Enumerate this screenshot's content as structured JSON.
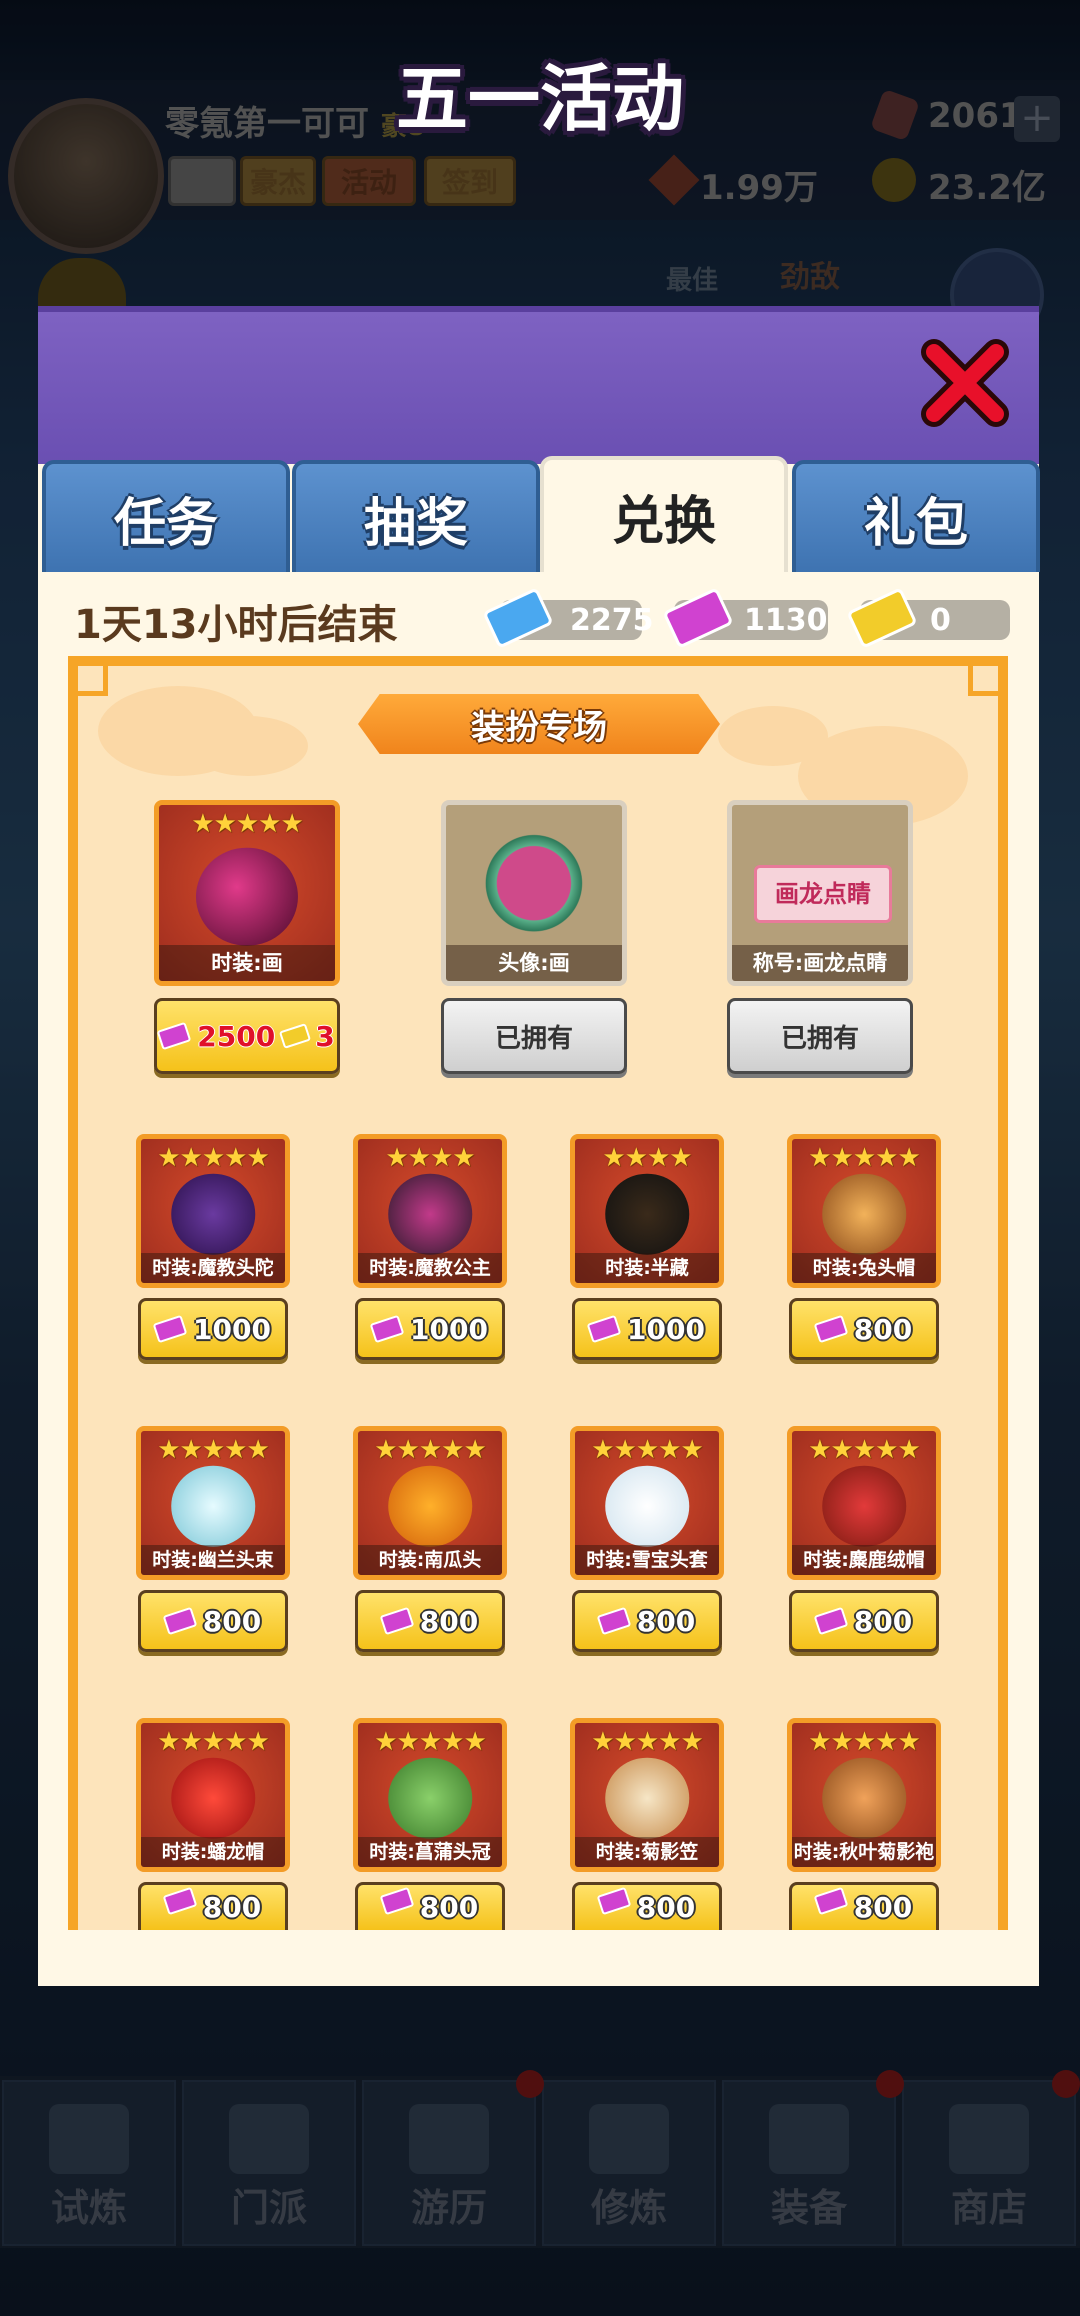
{
  "player": {
    "name": "零氪第一可可",
    "vip": "豪8",
    "menu": [
      "豪杰",
      "活动",
      "签到"
    ],
    "gems": "2061",
    "power": "1.99万",
    "coins": "23.2亿"
  },
  "modal": {
    "title": "五一活动",
    "tabs": [
      "任务",
      "抽奖",
      "兑换",
      "礼包"
    ],
    "active_tab": 2,
    "countdown": "1天13小时后结束",
    "currencies": [
      {
        "icon": "blue-ticket-icon",
        "color": "#4aa8f0",
        "value": "2275"
      },
      {
        "icon": "purple-ticket-icon",
        "color": "#d042d0",
        "value": "1130"
      },
      {
        "icon": "gold-ticket-icon",
        "color": "#f2cc2a",
        "value": "0"
      }
    ]
  },
  "shop": {
    "section_title": "装扮专场",
    "featured": [
      {
        "label": "时装:画",
        "stars": "★★★★★",
        "price": "2500",
        "price2": "3"
      },
      {
        "label": "头像:画",
        "status": "已拥有"
      },
      {
        "label": "称号:画龙点睛",
        "title_text": "画龙点睛",
        "status": "已拥有"
      }
    ],
    "items": [
      {
        "label": "时装:魔教头陀",
        "stars": "★★★★★",
        "price": "1000"
      },
      {
        "label": "时装:魔教公主",
        "stars": "★★★★",
        "price": "1000"
      },
      {
        "label": "时装:半藏",
        "stars": "★★★★",
        "price": "1000"
      },
      {
        "label": "时装:兔头帽",
        "stars": "★★★★★",
        "price": "800"
      },
      {
        "label": "时装:幽兰头束",
        "stars": "★★★★★",
        "price": "800"
      },
      {
        "label": "时装:南瓜头",
        "stars": "★★★★★",
        "price": "800"
      },
      {
        "label": "时装:雪宝头套",
        "stars": "★★★★★",
        "price": "800"
      },
      {
        "label": "时装:麋鹿绒帽",
        "stars": "★★★★★",
        "price": "800"
      },
      {
        "label": "时装:蟠龙帽",
        "stars": "★★★★★",
        "price": "800"
      },
      {
        "label": "时装:菖蒲头冠",
        "stars": "★★★★★",
        "price": "800"
      },
      {
        "label": "时装:菊影笠",
        "stars": "★★★★★",
        "price": "800"
      },
      {
        "label": "时装:秋叶菊影袍",
        "stars": "★★★★★",
        "price": "800"
      }
    ]
  },
  "nav": [
    "试炼",
    "门派",
    "游历",
    "修炼",
    "装备",
    "商店"
  ],
  "bg_text": [
    "最佳",
    "劲敌"
  ]
}
